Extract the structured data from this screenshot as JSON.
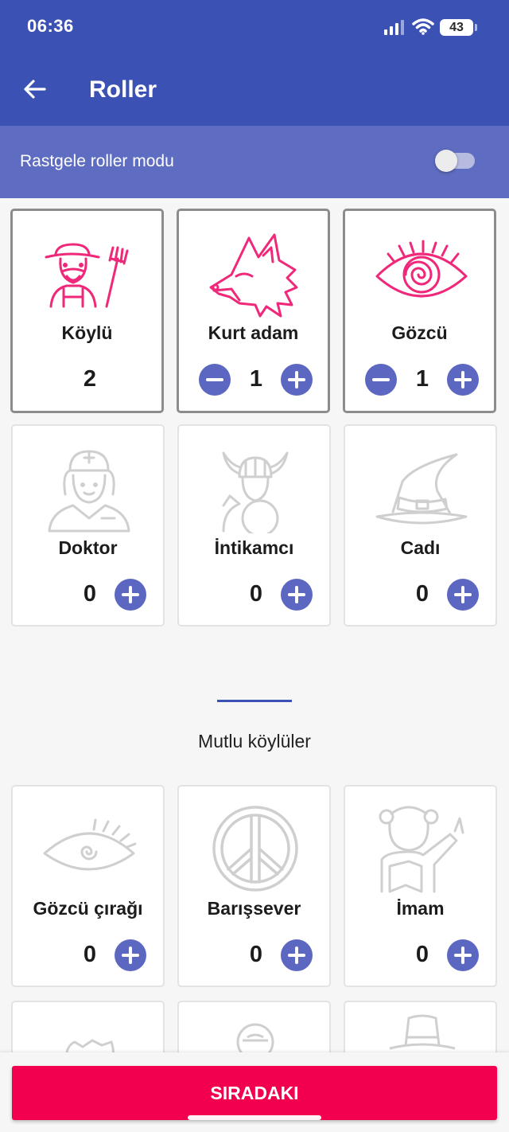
{
  "status": {
    "time": "06:36",
    "battery": "43"
  },
  "appbar": {
    "title": "Roller"
  },
  "mode": {
    "label": "Rastgele roller modu",
    "enabled": false
  },
  "roles_active": [
    {
      "name": "Köylü",
      "count": "2"
    },
    {
      "name": "Kurt adam",
      "count": "1"
    },
    {
      "name": "Gözcü",
      "count": "1"
    }
  ],
  "roles_inactive": [
    {
      "name": "Doktor",
      "count": "0"
    },
    {
      "name": "İntikamcı",
      "count": "0"
    },
    {
      "name": "Cadı",
      "count": "0"
    }
  ],
  "section": {
    "title": "Mutlu köylüler"
  },
  "happy_roles": [
    {
      "name": "Gözcü çırağı",
      "count": "0"
    },
    {
      "name": "Barışsever",
      "count": "0"
    },
    {
      "name": "İmam",
      "count": "0"
    }
  ],
  "footer": {
    "next_label": "SIRADAKI"
  },
  "colors": {
    "primary": "#3c51b4",
    "accent": "#f2004f",
    "active_icon": "#f0287a",
    "inactive_icon": "#cfcfcf"
  },
  "icons": [
    "back-arrow-icon",
    "farmer-icon",
    "wolf-icon",
    "eye-icon",
    "nurse-icon",
    "viking-icon",
    "witch-hat-icon",
    "eye-apprentice-icon",
    "peace-icon",
    "imam-icon"
  ]
}
